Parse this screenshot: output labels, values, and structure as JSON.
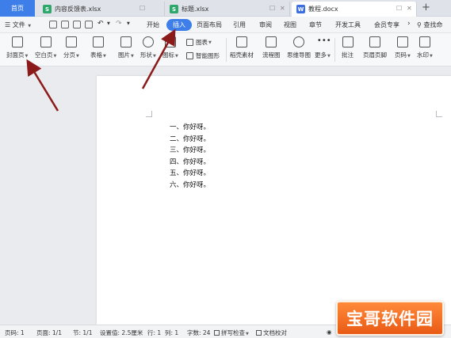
{
  "tabs": {
    "home": "首页",
    "files": [
      {
        "icon": "S",
        "name": "内容反馈表.xlsx"
      },
      {
        "icon": "S",
        "name": "标题.xlsx"
      },
      {
        "icon": "W",
        "name": "教程.docx"
      }
    ],
    "add": "+"
  },
  "menu": {
    "file": "文件",
    "items": [
      "开始",
      "插入",
      "页面布局",
      "引用",
      "审阅",
      "视图",
      "章节",
      "开发工具",
      "会员专享"
    ],
    "active": "插入",
    "search": "查找命"
  },
  "ribbon": {
    "buttons": [
      "封面页",
      "空白页",
      "分页",
      "表格",
      "图片",
      "形状",
      "图标",
      "稻壳素材",
      "流程图",
      "思维导图",
      "更多",
      "批注",
      "页眉页脚",
      "页码",
      "水印"
    ],
    "chart": "图表",
    "smart_shape": "智能图形"
  },
  "document": {
    "lines": [
      "一、你好呀。",
      "二、你好呀。",
      "三、你好呀。",
      "四、你好呀。",
      "五、你好呀。",
      "六、你好呀。"
    ]
  },
  "status": {
    "page_num": "页码: 1",
    "page": "页面: 1/1",
    "section": "节: 1/1",
    "setting": "设置值: 2.5厘米",
    "row": "行: 1",
    "col": "列: 1",
    "words": "字数: 24",
    "spell": "拼写检查",
    "proof": "文档校对"
  },
  "watermark": "宝哥软件园",
  "colors": {
    "accent": "#3d7ee8",
    "arrow": "#8b1a1a",
    "sheet_icon": "#2ea86a",
    "doc_icon": "#3b6ee0"
  }
}
